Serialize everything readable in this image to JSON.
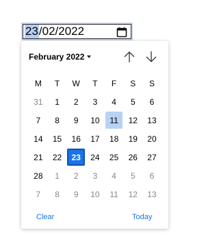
{
  "input": {
    "day": "23",
    "rest": "/02/2022"
  },
  "icons": {
    "calendar": "calendar-icon",
    "prev": "arrow-up-icon",
    "next": "arrow-down-icon",
    "dropdown": "caret-down-icon"
  },
  "colors": {
    "accent": "#1a73e8",
    "highlight": "#b8d1f5",
    "muted": "#888888"
  },
  "calendar": {
    "month_label": "February 2022",
    "weekdays": [
      "M",
      "T",
      "W",
      "T",
      "F",
      "S",
      "S"
    ],
    "days": [
      {
        "d": "31",
        "other": true
      },
      {
        "d": "1"
      },
      {
        "d": "2"
      },
      {
        "d": "3"
      },
      {
        "d": "4"
      },
      {
        "d": "5"
      },
      {
        "d": "6"
      },
      {
        "d": "7"
      },
      {
        "d": "8"
      },
      {
        "d": "9"
      },
      {
        "d": "10"
      },
      {
        "d": "11",
        "highlight": true
      },
      {
        "d": "12"
      },
      {
        "d": "13"
      },
      {
        "d": "14"
      },
      {
        "d": "15"
      },
      {
        "d": "16"
      },
      {
        "d": "17"
      },
      {
        "d": "18"
      },
      {
        "d": "19"
      },
      {
        "d": "20"
      },
      {
        "d": "21"
      },
      {
        "d": "22"
      },
      {
        "d": "23",
        "selected": true
      },
      {
        "d": "24"
      },
      {
        "d": "25"
      },
      {
        "d": "26"
      },
      {
        "d": "27"
      },
      {
        "d": "28"
      },
      {
        "d": "1",
        "other": true
      },
      {
        "d": "2",
        "other": true
      },
      {
        "d": "3",
        "other": true
      },
      {
        "d": "4",
        "other": true
      },
      {
        "d": "5",
        "other": true
      },
      {
        "d": "6",
        "other": true
      },
      {
        "d": "7",
        "other": true
      },
      {
        "d": "8",
        "other": true
      },
      {
        "d": "9",
        "other": true
      },
      {
        "d": "10",
        "other": true
      },
      {
        "d": "11",
        "other": true
      },
      {
        "d": "12",
        "other": true
      },
      {
        "d": "13",
        "other": true
      }
    ]
  },
  "footer": {
    "clear_label": "Clear",
    "today_label": "Today"
  }
}
